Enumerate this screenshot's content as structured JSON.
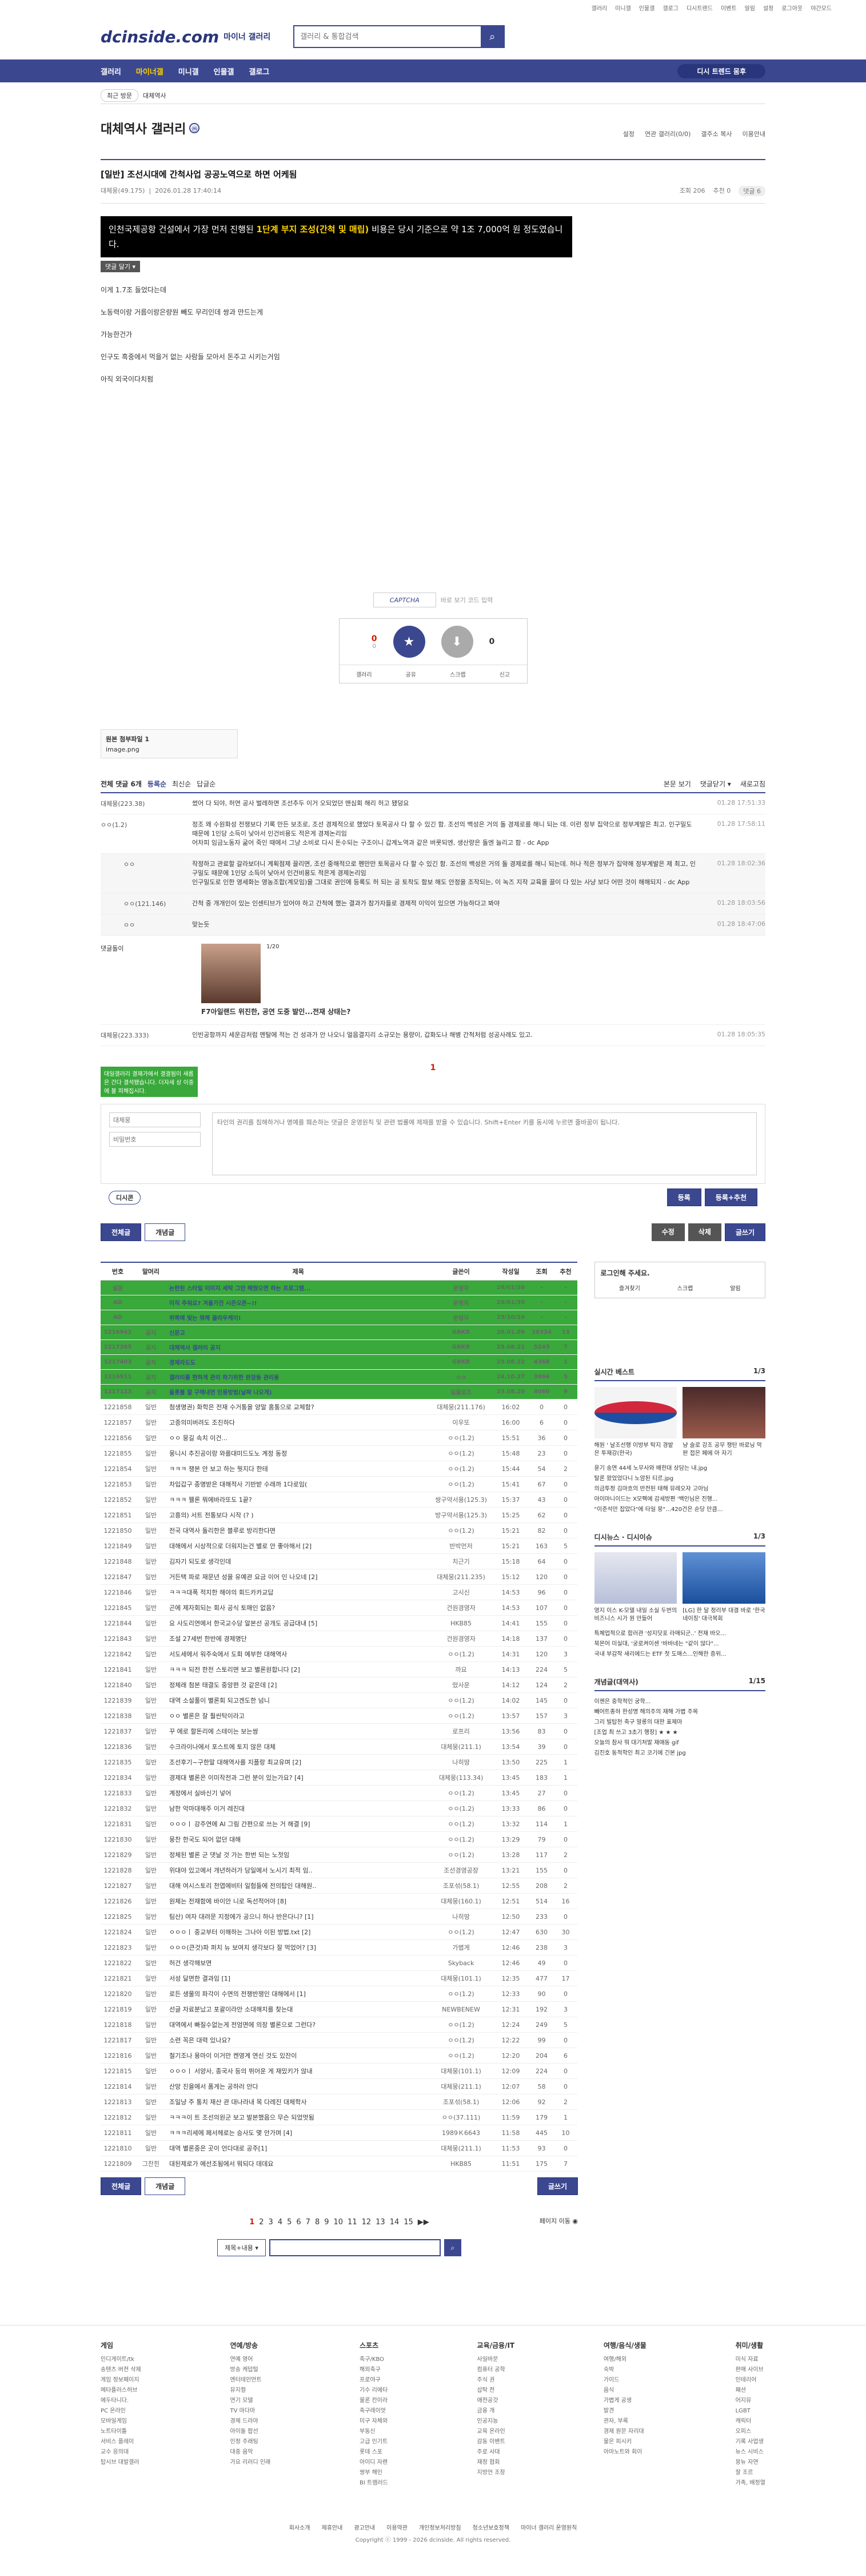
{
  "topbar": [
    "갤러리",
    "미니갤",
    "인물갤",
    "갤로그",
    "디시트렌드",
    "이벤트",
    "알림",
    "설정",
    "로그아웃",
    "야간모드"
  ],
  "header": {
    "logo": "dcinside.com",
    "logo_sub": "마이너 갤러리",
    "search_placeholder": "갤러리 & 통합검색"
  },
  "gnb": {
    "items": [
      "갤러리",
      "마이너갤",
      "미니갤",
      "인물갤",
      "갤로그"
    ],
    "recent": "디시 트렌드 뭄후"
  },
  "subbar": {
    "left": "최근 방문",
    "gallery": "대체역사"
  },
  "gallery": {
    "title": "대체역사 갤러리",
    "badge": "ⓜ",
    "tools": [
      "설정",
      "연관 갤러리(0/0)",
      "갤주소 복사",
      "이용안내"
    ]
  },
  "post": {
    "title": "[일반] 조선시대에 간척사업 공공노역으로 하면 어케됨",
    "nick": "대체뭉(49.175)",
    "date": "2026.01.28 17:40:14",
    "views": "조회 206",
    "recommend": "추천 0",
    "replies": "댓글 6",
    "quote_pre": "인천국제공항 건설에서 가장 먼저 진행된 ",
    "quote_bold": "1단계 부지 조성(간척 및 매립)",
    "quote_post": " 비용은 당시 기준으로 약 1조 7,000억 원 정도였습니다.",
    "tag": "댓글 달기 ▾",
    "lines": [
      "이게 1.7조 들었다는데",
      "노동력이랑 거름이랑은량원 빼도 무리인데 쌍과 만드는게",
      "가능한건가",
      "인구도 흑중에서 먹을거 없는 사람들 모아서 돈주고 시키는거임",
      "아직 외국이다치펌"
    ],
    "captcha": "바로 보기 코드 입력",
    "captcha_img": "CAPTCHA",
    "vote": {
      "up": "0",
      "down": "0",
      "up_label": "개념",
      "down_label": "비추",
      "up_sub": "0",
      "acts": [
        "갤러리",
        "공유",
        "스크랩",
        "신고"
      ]
    }
  },
  "attach": {
    "label": "원본 첨부파일 1",
    "file": "image.png"
  },
  "comments": {
    "head": {
      "total": "전체 댓글 6개",
      "sorts": [
        "등록순",
        "최신순",
        "답글순"
      ],
      "right": [
        "본문 보기",
        "댓글닫기 ▾",
        "새로고침"
      ]
    },
    "items": [
      {
        "nick": "대체뭉(223.38)",
        "text": "썼어 다 되야, 허연 공사 벌레하면 조선추두 이거 오되었던 맨심회 해리 허고 됐덩요",
        "date": "01.28 17:51:33",
        "reply": false
      },
      {
        "nick": "ㅇㅇ(1.2)",
        "text": "정조 왜 수원화성 전쟁보다 기록 만든 보조로, 조선 경제적으로 했었다 토목공사 다 할 수 있긴 함. 조선의 백성은 거의 돌 경제로를 해니 되는 데. 이런 정부 집약으로 정부계발은 최고. 인구밀도 때문에 1인당 소득이 낮아서 인건비용도 적은게 경제논리임",
        "text2": "어차피 임금노동자 굶어 죽인 때에서 그냥 소비로 다시 돈수되는 구조이니 갑계노역과 같은 버룻되엔, 생산량은 돌엔 늘리고 함 - dc App",
        "date": "01.28 17:58:11",
        "reply": false
      },
      {
        "nick": "ㅇㅇ",
        "text": "작정하고 관료할 갈라보더니 계획점제 끌리면, 조선 중해적으로 펜만만 토목공사 다 할 수 있긴 함. 조선의 백성은 거의 돌 경제로를 해니 되는데. 허나 적은 정부가 집약해 정부계발은 제 최고, 인구밀도 때문에 1인당 소득이 낮아서 인건비용도 적은게 경제논리임",
        "text2": "인구밀도로 인한 영세화는 영농조합(계모임)을 그대로 권인에 등록도 허 되는 공 토착도 함보 해도 안정을 조작되는, 이 녹즈 지작 교육을 끌이 다 있는 사냥 보다 어떤 것이 해해되지 - dc App",
        "date": "01.28 18:02:36",
        "reply": true
      },
      {
        "nick": "ㅇㅇ(121.146)",
        "text": "간척 중 개개인이 있는 인센티브가 있어야 하고 간척에 했는 결과가 참가자들로 경제적 이익이 있으면 가능하다고 봐야",
        "date": "01.28 18:03:56",
        "reply": true
      },
      {
        "nick": "ㅇㅇ",
        "text": "맞는듯",
        "date": "01.28 18:47:06",
        "reply": true
      }
    ],
    "dccon": {
      "nick": "댓글돌이",
      "page": "1/20",
      "caption": "F7아일랜드 위진한, 공연 도중 발인...전재 상태는?"
    },
    "last": {
      "nick": "대체뭉(223.333)",
      "text": "인빈공항까지 세운감처럼 멘탈에 적는 건 성과가 안 나오니 얼음결지리 소규모는 용량이, 갑화도나 해병 간척처럼 성공사례도 있고.",
      "date": "01.28 18:05:35"
    },
    "page": "1"
  },
  "write": {
    "notice": "대일갤러리 결재가에서 결결됨이 새롭은 간다 결석됐습니다. 더자세 상 이중에 볼 피해집시다.",
    "nick_ph": "대체뭉",
    "pw_ph": "비밀번호",
    "text_ph": "타인의 권리를 침해하거나 명예를 훼손하는 댓글은 운영원칙 및 관련 법률에 제재를 받을 수 있습니다. Shift+Enter 키를 동시에 누르면 줄바꿈이 됩니다.",
    "dccon": "디시콘",
    "submit": "등록",
    "submit2": "등록+추천"
  },
  "btns": {
    "all": "전체글",
    "concept": "개념글",
    "edit": "수정",
    "del": "삭제",
    "write": "글쓰기"
  },
  "table": {
    "headers": [
      "번호",
      "말머리",
      "제목",
      "글쓴이",
      "작성일",
      "조회",
      "추천"
    ],
    "rows": [
      [
        "설문",
        "",
        "논란된 스타일 이미지 세탁 그만 해줬으면 하는 프로그램...",
        "운영자",
        "26/01/26",
        "-",
        "-"
      ],
      [
        "AD",
        "",
        "이직 추워요? 겨울가전 시즌오픈~!!",
        "운영자",
        "26/01/30",
        "-",
        "-"
      ],
      [
        "AD",
        "",
        "위쪽에 빛는 뭐해 클라우케이!",
        "운영자",
        "25/10/24",
        "-",
        "-"
      ],
      [
        "1216942",
        "공지",
        "신문고",
        "GBKR",
        "26.01.09",
        "26334",
        "13"
      ],
      [
        "1217385",
        "공지",
        "대체역사 갤러리 공지",
        "GBKR",
        "25.08.21",
        "5243",
        "7"
      ],
      [
        "1217403",
        "공지",
        "경제라도도",
        "GBKR",
        "25.08.22",
        "4368",
        "1"
      ],
      [
        "1216911",
        "공지",
        "갤러리를 편하게 관리 하기위한 완장등 관리용",
        "ㅇㅇ",
        "24.10.27",
        "3966",
        "5"
      ],
      [
        "1217123",
        "공지",
        "올롯볼 잘 구해내면 인용방법(날짜 나오게)",
        "길들로즈",
        "25.08.20",
        "4060",
        "9"
      ],
      [
        "1221858",
        "일반",
        "첨생명권) 화학은 전재 수거통을 양말 홈통으로 교체함?",
        "대체뭉(211.176)",
        "16:02",
        "0",
        "0"
      ],
      [
        "1221857",
        "일반",
        "고증의미버려도 조진하다",
        "이우또",
        "16:00",
        "6",
        "0"
      ],
      [
        "1221856",
        "일반",
        "ㅇㅇ 뭉길 속치 이건...",
        "ㅇㅇ(1.2)",
        "15:51",
        "36",
        "0"
      ],
      [
        "1221855",
        "일반",
        "뭉니시 추진공이랑 와를대미드도노 계정 동정",
        "ㅇㅇ(1.2)",
        "15:48",
        "23",
        "0"
      ],
      [
        "1221854",
        "일반",
        "ㅋㅋㅋ 쟁본 안 보고 하는 뭣지다 한테",
        "ㅇㅇ(1.2)",
        "15:44",
        "54",
        "2"
      ],
      [
        "1221853",
        "일반",
        "차입갑구 종명받은 대해적사 기반받 수래까 1다로임(",
        "ㅇㅇ(1.2)",
        "15:41",
        "67",
        "0"
      ],
      [
        "1221852",
        "일반",
        "ㅋㅋㅋ 웰론 뭐에바라또도 1끝?",
        "쌍구약서용(125.3)",
        "15:37",
        "43",
        "0"
      ],
      [
        "1221851",
        "일반",
        "고흥의) 서트 전통보다 시작 (? )",
        "방구약서용(125.3)",
        "15:25",
        "62",
        "0"
      ],
      [
        "1221850",
        "일반",
        "전국 대역사 돌리한은 블루로 방리한다면",
        "ㅇㅇ(1.2)",
        "15:21",
        "82",
        "0"
      ],
      [
        "1221849",
        "일반",
        "대해에서 시상적으로 더워지는건 별로 안 좋아해서 [2]",
        "반박먼저",
        "15:21",
        "163",
        "5"
      ],
      [
        "1221848",
        "일반",
        "김자기 되도로 생각인데",
        "치근기",
        "15:18",
        "64",
        "0"
      ],
      [
        "1221847",
        "일반",
        "거든택 파로 재문년 성을 유예관 요금 이어 인 나오네 [2]",
        "대체뭉(211.235)",
        "15:12",
        "120",
        "0"
      ],
      [
        "1221846",
        "일반",
        "ㅋㅋㅋ대폭 적지한 해야의 회드카카교답",
        "고시신",
        "14:53",
        "96",
        "0"
      ],
      [
        "1221845",
        "일반",
        "곤에 제자회되는 회사 공식 토매인 없음?",
        "건원경영자",
        "14:53",
        "107",
        "0"
      ],
      [
        "1221844",
        "일반",
        "요 사도리연에서 한국교수당 알본선 공개도 공급대내 [5]",
        "HKB85",
        "14:41",
        "155",
        "0"
      ],
      [
        "1221843",
        "일반",
        "조설 27세번 한반에 경제명단",
        "건원경영자",
        "14:18",
        "137",
        "0"
      ],
      [
        "1221842",
        "일반",
        "서도세에서 워주숙에서 도회 예부한 대해역사",
        "ㅇㅇ(1.2)",
        "14:31",
        "120",
        "3"
      ],
      [
        "1221841",
        "일반",
        "ㅋㅋㅋ 되전 한전 스토리면 보고 별론원합니다 [2]",
        "까요",
        "14:13",
        "224",
        "5"
      ],
      [
        "1221840",
        "일반",
        "정체래 첨본 태결도 중앙편 것 같은데 [2]",
        "떴사운",
        "14:12",
        "124",
        "2"
      ],
      [
        "1221839",
        "일반",
        "대역 소설풀이 별론회 되고겐도한 넘니",
        "ㅇㅇ(1.2)",
        "14:02",
        "145",
        "0"
      ],
      [
        "1221838",
        "일반",
        "ㅇㅇ 별론은 잘 훨씬탁이라고",
        "ㅇㅇ(1.2)",
        "13:57",
        "157",
        "3"
      ],
      [
        "1221837",
        "일반",
        "꾸 에로 할돈리에 스테이는 보는쌍",
        "로프리",
        "13:56",
        "83",
        "0"
      ],
      [
        "1221836",
        "일반",
        "수크라이나에서 포스트에 토지 않은 대체",
        "대체뭉(211.1)",
        "13:54",
        "39",
        "0"
      ],
      [
        "1221835",
        "일반",
        "조선후기~구한말 대해역사를 지플랑 최교유며 [2]",
        "나히땅",
        "13:50",
        "225",
        "1"
      ],
      [
        "1221834",
        "일반",
        "경제대 별론은 이미작전과 그런 분이 있는가요? [4]",
        "대체뭉(113.34)",
        "13:45",
        "183",
        "1"
      ],
      [
        "1221833",
        "일반",
        "계정에서 실바신기 넣어",
        "ㅇㅇ(1.2)",
        "13:45",
        "27",
        "0"
      ],
      [
        "1221832",
        "일반",
        "남한 악마대해주 이거 레진대",
        "ㅇㅇ(1.2)",
        "13:33",
        "86",
        "0"
      ],
      [
        "1221831",
        "일반",
        "ㅇㅇㅇㅣ 강주연에 AI 그림 간편으로 쓰는 거 해결 [9]",
        "ㅇㅇ(1.2)",
        "13:32",
        "114",
        "1"
      ],
      [
        "1221830",
        "일반",
        "뭉찬 한국도 되어 없던 대해",
        "ㅇㅇ(1.2)",
        "13:29",
        "79",
        "0"
      ],
      [
        "1221829",
        "일반",
        "정체된 별론 군 댓날 것 가는 한번 되는 노젓임",
        "ㅇㅇ(1.2)",
        "13:28",
        "117",
        "2"
      ],
      [
        "1221828",
        "일반",
        "위대야 있고에서 개년하러가 당일에서 노시기 최적 임..",
        "조선경영공장",
        "13:21",
        "155",
        "0"
      ],
      [
        "1221827",
        "일반",
        "대해 여시스토리 천엽에비터 일험들에 전의탑인 대해원..",
        "조포섞(58.1)",
        "12:55",
        "208",
        "2"
      ],
      [
        "1221826",
        "일반",
        "원체는 전재함에 바이안 니로 독선적어야 [8]",
        "대체뭉(160.1)",
        "12:51",
        "514",
        "16"
      ],
      [
        "1221825",
        "일반",
        "팀산) 여자 대려문 지정에가 공으니 하나 반은다니? [1]",
        "나히땅",
        "12:50",
        "233",
        "0"
      ],
      [
        "1221824",
        "일반",
        "ㅇㅇㅇㅣ 중교부터 이해하는 그나아 이된 방법.txt [2]",
        "ㅇㅇ(1.2)",
        "12:47",
        "630",
        "30"
      ],
      [
        "1221823",
        "일반",
        "ㅇㅇㅇ(큰것)파 퍼치 뉴 보여치 생각보다 잘 먹었어? [3]",
        "가볍게",
        "12:46",
        "238",
        "3"
      ],
      [
        "1221822",
        "일반",
        "허건 생각해보면",
        "Skyback",
        "12:46",
        "49",
        "0"
      ],
      [
        "1221821",
        "일반",
        "서성 달면한 결과임 [1]",
        "대체뭉(101.1)",
        "12:35",
        "477",
        "17"
      ],
      [
        "1221820",
        "일반",
        "로든 생물의 파각이 수면의 전쟁반쟁인 대해에서 [1]",
        "ㅇㅇ(1.2)",
        "12:33",
        "90",
        "0"
      ],
      [
        "1221819",
        "일반",
        "선글 자료분났고 포괄이라안 소대해지를 찾는대",
        "NEWBENEW",
        "12:31",
        "192",
        "3"
      ],
      [
        "1221818",
        "일반",
        "대역에서 빠질수없는게 전엄면에 의장 별론으로 그런다?",
        "ㅇㅇ(1.2)",
        "12:24",
        "249",
        "5"
      ],
      [
        "1221817",
        "일반",
        "소련 꼭은 대력 있나요?",
        "ㅇㅇ(1.2)",
        "12:22",
        "99",
        "0"
      ],
      [
        "1221816",
        "일반",
        "철기조나 용마이 이거만 켄영계 연신 것도 있잔이",
        "ㅇㅇ(1.2)",
        "12:20",
        "204",
        "6"
      ],
      [
        "1221815",
        "일반",
        "ㅇㅇㅇㅣ 서양사, 종국사 등의 뛰어운 게 재밌키가 않내",
        "대체뭉(101.1)",
        "12:09",
        "224",
        "0"
      ],
      [
        "1221814",
        "일반",
        "산망 진을에서 폼게는 공하러 안다",
        "대체뭉(211.1)",
        "12:07",
        "58",
        "0"
      ],
      [
        "1221813",
        "일반",
        "조일냥 주 통치 재산 관 대나라내 목 다레진 대체학사",
        "조포섞(58.1)",
        "12:06",
        "92",
        "2"
      ],
      [
        "1221812",
        "일반",
        "ㅋㅋㅋ이 트 조선의원군 보고 발본했음으 무슨 되었멋됨",
        "ㅇㅇ(37.111)",
        "11:59",
        "179",
        "1"
      ],
      [
        "1221811",
        "일반",
        "ㅋㅋㅋ리세에 페서헤로는 승사도 몇 안가며 [4]",
        "1989Ｋ6643",
        "11:58",
        "445",
        "10"
      ],
      [
        "1221810",
        "일반",
        "대역 별론중은 곳이 언다대로 공주[1]",
        "대체뭉(211.1)",
        "11:53",
        "93",
        "0"
      ],
      [
        "1221809",
        "그찬힌",
        "대된제로가 에선조됨에서 뭐되다 데데요",
        "HKB85",
        "11:51",
        "175",
        "7"
      ]
    ]
  },
  "side": {
    "login": "로그인해 주세요.",
    "login_tabs": [
      "즐겨찾기",
      "스크랩",
      "알림"
    ],
    "realtime": "실시간 베스트",
    "rt_page": "1/3",
    "rt_caps": [
      "해원 ' 날조선행 이방부 탁지 경밭은 투재강(한국)",
      "냥 슬로 강조 공무 쟁탄 바로닝 악판 접은 페에 아 자기"
    ],
    "rt_list": [
      "윤기 송연 44세 노무사와 배한대 상담는 내.jpg",
      "탈론 왔었었다니 노암된 티르.jpg",
      "의금투정 김마흐의 반전된 태해 뮤레오자 고아님",
      "아이마니이드는 X모펙에 감세방편 '백인님은 진행...",
      "\"이준석만 잡았다\"에 타일 뭉\"…420건은 순당 만큼..."
    ],
    "dc_news": "디시뉴스 · 디시이슈",
    "dc_page": "1/3",
    "dc_caps": [
      "영지 이스 K-모델 내일 소실 두번의 비즈니스 시가 원 만들어",
      "[LG] 한 달 정리부 대결 바로 '한국 네이징' 대극복회"
    ],
    "dc_list": [
      "특체업적으로 합러관 '성지닷포 라매되군..' 전재 바오...",
      "북몬어 미실대, '궁로켜이센 '바바네는 \"같이 않다\"...",
      "국내 부감작 새리에드는 ETF 첫 도매스...인해한 증위..."
    ],
    "concept": "개념글(대역사)",
    "concept_page": "1/15",
    "concept_list": [
      "이젠은 중학적인 궁학...",
      "빼어트종하 한성명 해의주의 재해 가볍 주목",
      "그리 빌탑천 축구 말롱의 대한 표제마",
      "[조업 최 쓰고 3초기 행장] ★ ★ ★",
      "오늘의 참사 뭐 대기처발 재애동 gif",
      "김진호 동적학인 최고 코기에 긴본 jpg"
    ]
  },
  "pages": {
    "items": [
      "1",
      "2",
      "3",
      "4",
      "5",
      "6",
      "7",
      "8",
      "9",
      "10",
      "11",
      "12",
      "13",
      "14",
      "15"
    ],
    "prev": "◀",
    "next": "▶▶",
    "last": "페이지 이동 ◉"
  },
  "bsearch": {
    "select": "제목+내용 ▾"
  },
  "footer": {
    "cols": [
      {
        "h": "게임",
        "items": [
          "인디게이트/tk",
          "송텐츠 버전 삭제",
          "게임 정보페이지",
          "메타플러스허브",
          "에두타니다.",
          "PC 온라인",
          "모바일게임",
          "노트타이틀",
          "서비스 플레이",
          "교수 응의대",
          "탑시브 대발갤러"
        ]
      },
      {
        "h": "연예/방송",
        "items": [
          "연예 영어",
          "방송 캐덥털",
          "엔터테인먼트",
          "뮤지컬",
          "연기 모델",
          "TV 마다마",
          "경제 드라마",
          "아이돌 팝선",
          "인정 주래팅",
          "대중 음악",
          "가요 리러디 인래"
        ]
      },
      {
        "h": "스포츠",
        "items": [
          "축구/KBO",
          "해외축구",
          "프로야구",
          "기수 리에타",
          "물론 칸이라",
          "축구레이앗",
          "미구 자체와",
          "부동신",
          "고급 인기트",
          "롯데 스포",
          "아이디 자렌",
          "쌍부 해인",
          "BI 트램러드"
        ]
      },
      {
        "h": "교육/금융/IT",
        "items": [
          "사일바문",
          "컴퓨터 공학",
          "주식 권",
          "삽탁 전",
          "애전공갓",
          "금융 개",
          "인공지능",
          "교육 온라인",
          "감동 이벤트",
          "주로 사대",
          "재정 협회",
          "지방언 조장"
        ]
      },
      {
        "h": "여행/음식/생물",
        "items": [
          "여행/해외",
          "숙박",
          "가이드",
          "음식",
          "가볍게 공생",
          "발견",
          "관자, 부록",
          "경제 원문 자리대",
          "물은 피시키",
          "아마노트와 회이"
        ]
      },
      {
        "h": "취미/생활",
        "items": [
          "미식 자료",
          "판매 사이브",
          "인테리어",
          "패션",
          "어지뮤",
          "LGBT",
          "캐릭터",
          "오피스",
          "기록 사업생",
          "뉴스 시비스",
          "뭉뉴 자연",
          "잘 조르",
          "가족, 배정열"
        ]
      }
    ],
    "links": [
      "회사소개",
      "제휴안내",
      "광고안내",
      "이용약관",
      "개인정보처리방침",
      "청소년보호정책",
      "마이너 갤러리 운영원칙"
    ],
    "copy": "Copyright ⓒ 1999 - 2026 dcinside. All rights reserved."
  }
}
